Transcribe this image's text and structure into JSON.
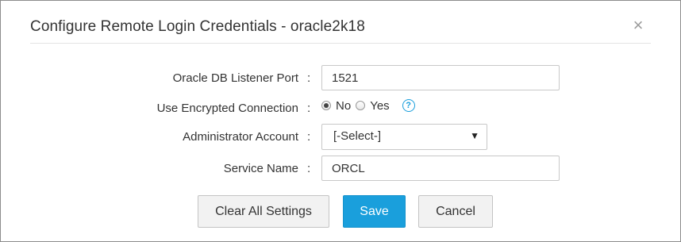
{
  "dialog": {
    "title": "Configure Remote Login Credentials - oracle2k18",
    "close_glyph": "×"
  },
  "form": {
    "colon": ":",
    "listener_port": {
      "label": "Oracle DB Listener Port",
      "value": "1521"
    },
    "encrypted_connection": {
      "label": "Use Encrypted Connection",
      "options": [
        {
          "label": "No",
          "checked": true
        },
        {
          "label": "Yes",
          "checked": false
        }
      ],
      "help_glyph": "?"
    },
    "admin_account": {
      "label": "Administrator Account",
      "selected": "[-Select-]",
      "arrow_glyph": "▼"
    },
    "service_name": {
      "label": "Service Name",
      "value": "ORCL"
    }
  },
  "buttons": {
    "clear": "Clear All Settings",
    "save": "Save",
    "cancel": "Cancel"
  },
  "colors": {
    "primary": "#1a9fdc",
    "border": "#8c8c8c"
  },
  "icons": {
    "close": "close-icon",
    "help": "help-icon",
    "dropdown": "chevron-down-icon"
  }
}
